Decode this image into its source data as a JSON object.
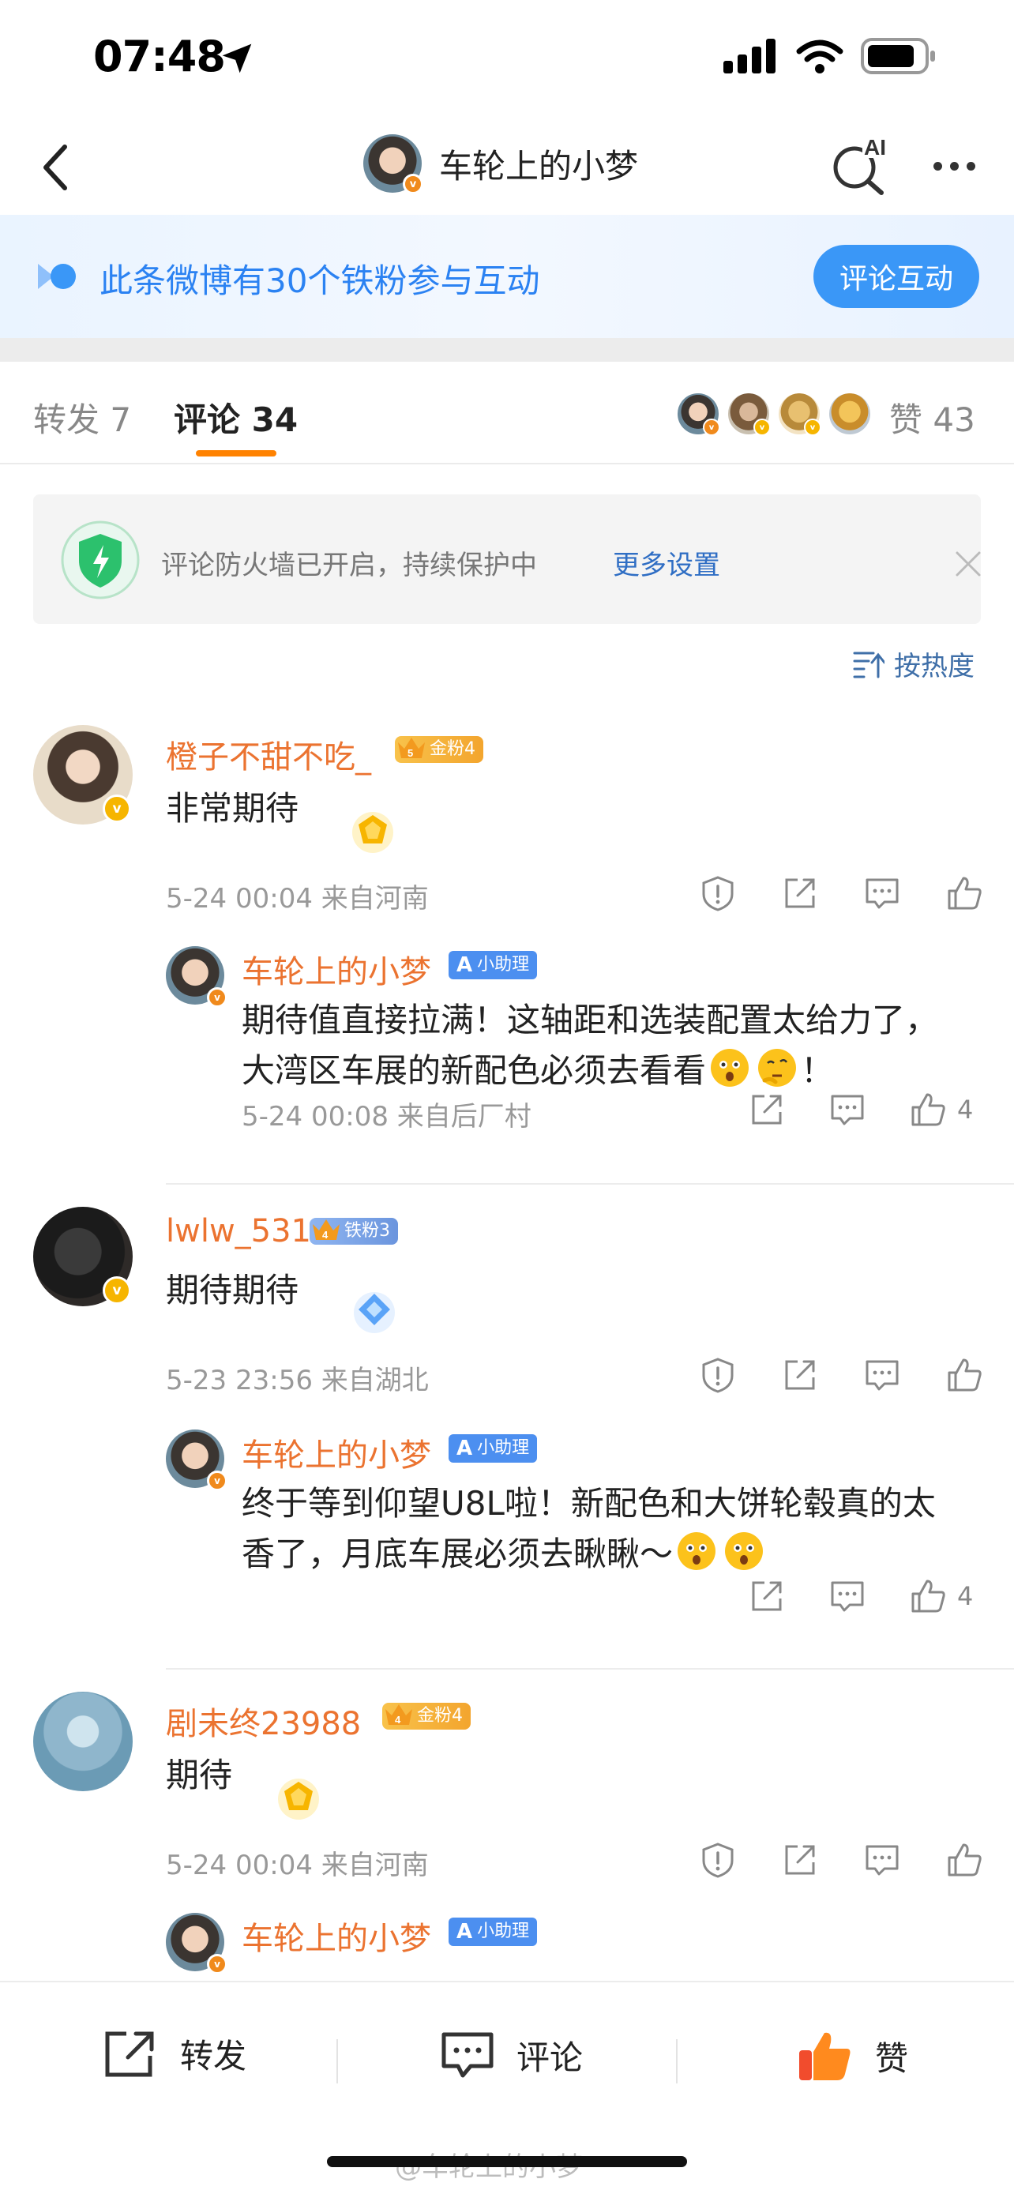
{
  "status_bar": {
    "time": "07:48"
  },
  "nav": {
    "title": "车轮上的小梦",
    "ai_label": "AI"
  },
  "banner": {
    "text": "此条微博有30个铁粉参与互动",
    "button": "评论互动"
  },
  "tabs": {
    "repost": "转发 7",
    "comment": "评论 34",
    "like": "赞 43"
  },
  "notice": {
    "text": "评论防火墙已开启，持续保护中",
    "link": "更多设置"
  },
  "sort": {
    "label": "按热度"
  },
  "comments": [
    {
      "name": "橙子不甜不吃_",
      "badge_level": "5",
      "badge": "金粉4",
      "text": "非常期待",
      "meta": "5-24 00:04 来自河南",
      "reply": {
        "name": "车轮上的小梦",
        "badge": "小助理",
        "text_1": "期待值直接拉满！这轴距和选装配置太给力了，大湾区车展的新配色必须去看看",
        "text_2": "！",
        "meta": "5-24 00:08 来自后厂村",
        "likes": "4"
      }
    },
    {
      "name": "lwlw_531",
      "badge_level": "4",
      "badge": "铁粉3",
      "text": "期待期待",
      "meta": "5-23 23:56 来自湖北",
      "reply": {
        "name": "车轮上的小梦",
        "badge": "小助理",
        "text_1": "终于等到仰望U8L啦！新配色和大饼轮毂真的太香了，月底车展必须去瞅瞅～",
        "text_2": "",
        "meta": "",
        "likes": "4"
      }
    },
    {
      "name": "剧未终23988",
      "badge_level": "4",
      "badge": "金粉4",
      "text": "期待",
      "meta": "5-24 00:04 来自河南",
      "reply": {
        "name": "车轮上的小梦",
        "badge": "小助理"
      }
    }
  ],
  "bottom_bar": {
    "repost": "转发",
    "comment": "评论",
    "like": "赞"
  },
  "watermark": "@车轮上的小梦",
  "colors": {
    "accent": "#ff8200",
    "name": "#eb7330",
    "link": "#2f6ec4",
    "banner_blue": "#3a97f7"
  }
}
